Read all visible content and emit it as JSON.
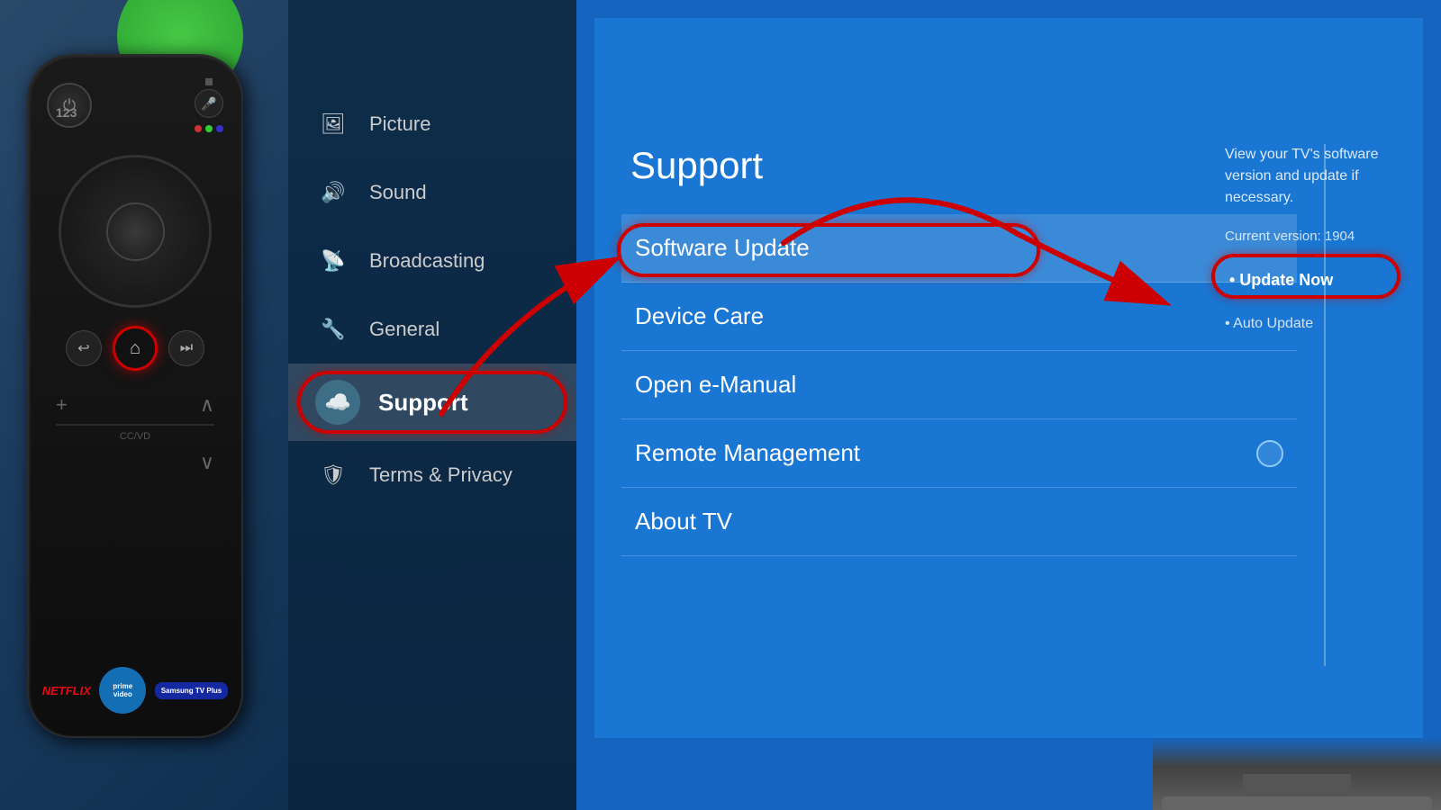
{
  "left": {
    "remote": {
      "power_symbol": "⏻",
      "mic_symbol": "🎤",
      "num_label": "123",
      "dots_colors": [
        "#ff4444",
        "#44ff44",
        "#4444ff"
      ],
      "nav_hint": "●",
      "back_symbol": "↩",
      "forward_symbol": "⏭",
      "home_symbol": "⌂",
      "plus_symbol": "+",
      "up_symbol": "∧",
      "down_symbol": "∨",
      "cc_label": "CC/VD",
      "netflix_label": "NETFLIX",
      "prime_label": "prime video",
      "samsung_label": "Samsung TV Plus"
    }
  },
  "middle_menu": {
    "items": [
      {
        "label": "Picture",
        "icon": "🖼"
      },
      {
        "label": "Sound",
        "icon": "🔊"
      },
      {
        "label": "Broadcasting",
        "icon": "📡"
      },
      {
        "label": "General",
        "icon": "🔧"
      },
      {
        "label": "Support",
        "icon": "☁",
        "active": true
      },
      {
        "label": "Terms & Privacy",
        "icon": "🛡"
      }
    ]
  },
  "tv_screen": {
    "support_title": "Support",
    "menu_items": [
      {
        "label": "Software Update",
        "highlighted": true
      },
      {
        "label": "Device Care"
      },
      {
        "label": "Open e-Manual"
      },
      {
        "label": "Remote Management",
        "has_toggle": true
      },
      {
        "label": "About TV"
      }
    ],
    "info_panel": {
      "description": "View your TV's software version and update if necessary.",
      "version_text": "Current version: 1904",
      "update_now_label": "• Update Now",
      "auto_update_label": "• Auto Update"
    }
  },
  "annotations": {
    "arrow1_label": "→",
    "arrow2_label": "→"
  }
}
